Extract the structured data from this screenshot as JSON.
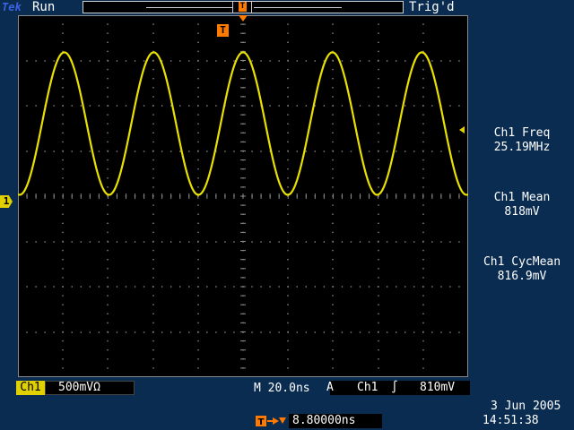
{
  "header": {
    "brand": "Tek",
    "acq_state": "Run",
    "trigger_state": "Trig'd"
  },
  "markers": {
    "trigger_marker": "T",
    "channel_marker": "1"
  },
  "measurements": [
    {
      "label": "Ch1 Freq",
      "value": "25.19MHz"
    },
    {
      "label": "Ch1 Mean",
      "value": "818mV"
    },
    {
      "label": "Ch1 CycMean",
      "value": "816.9mV"
    }
  ],
  "readouts": {
    "channel": "Ch1",
    "vertical_scale": "500mV",
    "coupling_symbol": "Ω",
    "timebase": "M 20.0ns",
    "trigger_source_prefix": "A",
    "trigger_source": "Ch1",
    "trigger_slope_symbol": "∫",
    "trigger_level": "810mV",
    "delay_value": "8.80000ns",
    "date": "3 Jun  2005",
    "time": "14:51:38"
  },
  "colors": {
    "background": "#0a2c50",
    "screen": "#000000",
    "trace": "#e8e000",
    "graticule": "#8a8a8a",
    "trigger_accent": "#ff7a00"
  },
  "waveform": {
    "type": "line",
    "shape": "sine",
    "frequency_mhz": 25.19,
    "time_per_div_ns": 20,
    "volts_per_div_mv": 500,
    "horizontal_divs": 10,
    "vertical_divs": 8,
    "peak_div_above_ground": 3.2,
    "trough_div_above_ground": 0.05,
    "trigger_time_ns": 0
  }
}
